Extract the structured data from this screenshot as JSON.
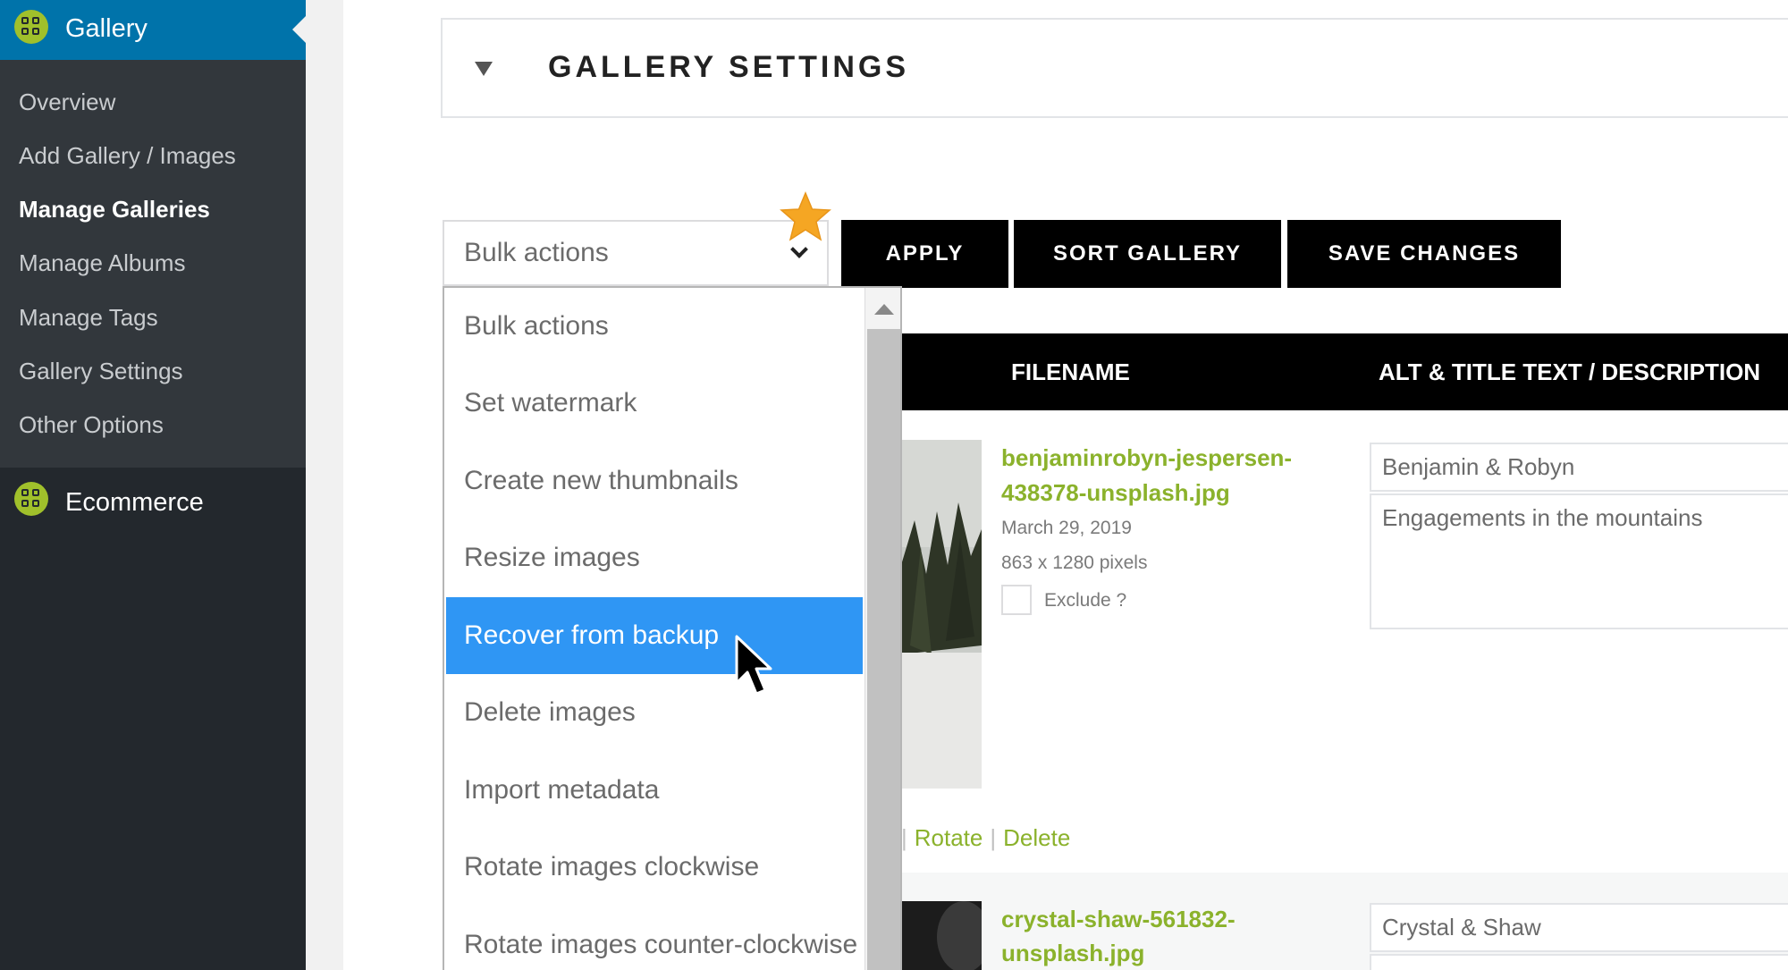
{
  "sidebar": {
    "top_label": "Gallery",
    "items": [
      {
        "label": "Overview"
      },
      {
        "label": "Add Gallery / Images"
      },
      {
        "label": "Manage Galleries"
      },
      {
        "label": "Manage Albums"
      },
      {
        "label": "Manage Tags"
      },
      {
        "label": "Gallery Settings"
      },
      {
        "label": "Other Options"
      }
    ],
    "active_item": "Manage Galleries",
    "ecommerce_label": "Ecommerce"
  },
  "panel": {
    "title": "GALLERY SETTINGS"
  },
  "bulk": {
    "selected_value": "Bulk actions",
    "options": [
      "Bulk actions",
      "Set watermark",
      "Create new thumbnails",
      "Resize images",
      "Recover from backup",
      "Delete images",
      "Import metadata",
      "Rotate images clockwise",
      "Rotate images counter-clockwise"
    ],
    "highlighted_option": "Recover from backup"
  },
  "toolbar": {
    "apply_label": "APPLY",
    "sort_label": "SORT GALLERY",
    "save_label": "SAVE CHANGES"
  },
  "table": {
    "headers": {
      "filename": "FILENAME",
      "alt": "ALT & TITLE TEXT / DESCRIPTION"
    },
    "rows": [
      {
        "filename_line1": "benjaminrobyn-jespersen-",
        "filename_line2": "438378-unsplash.jpg",
        "date": "March 29, 2019",
        "dimensions": "863 x 1280 pixels",
        "exclude_label": "Exclude ?",
        "alt_text": "Benjamin & Robyn",
        "description": "Engagements in the mountains",
        "actions": {
          "rotate": "Rotate",
          "delete": "Delete"
        }
      },
      {
        "filename_line1": "crystal-shaw-561832-",
        "filename_line2": "unsplash.jpg",
        "alt_text": "Crystal & Shaw"
      }
    ]
  },
  "colors": {
    "sidebar_bg": "#23282d",
    "sidebar_active": "#0073aa",
    "accent_green": "#8bb22c",
    "dropdown_highlight": "#2f96f4",
    "icon_green": "#a0c02b"
  },
  "icons": {
    "sidebar_gallery": "gallery-grid-icon",
    "sidebar_ecommerce": "ecommerce-grid-icon",
    "panel_toggle": "triangle-down-icon",
    "select_caret": "chevron-down-icon",
    "star": "star-icon",
    "cursor": "mouse-pointer-icon"
  }
}
